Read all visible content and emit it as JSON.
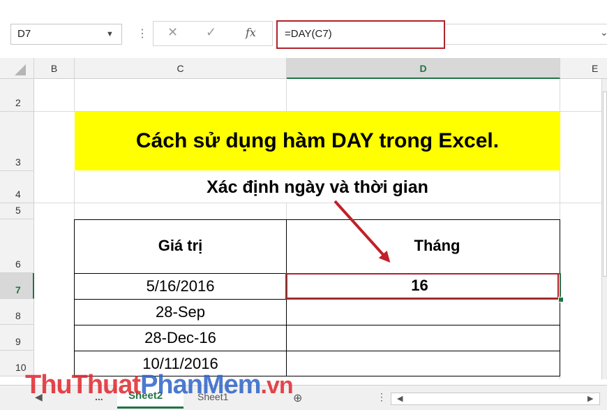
{
  "formula_bar": {
    "name_box": "D7",
    "formula": "=DAY(C7)",
    "fx_label": "fx"
  },
  "columns": [
    "B",
    "C",
    "D",
    "E"
  ],
  "rows": [
    "2",
    "3",
    "4",
    "5",
    "6",
    "7",
    "8",
    "9",
    "10"
  ],
  "sheet": {
    "title": "Cách sử dụng hàm DAY trong Excel.",
    "subtitle": "Xác định ngày và thời gian",
    "table": {
      "headers": [
        "Giá trị",
        "Tháng"
      ],
      "values": [
        "5/16/2016",
        "28-Sep",
        "28-Dec-16",
        "10/11/2016"
      ],
      "result": "16"
    }
  },
  "tabs": {
    "more": "...",
    "active": "Sheet2",
    "other": "Sheet1"
  },
  "watermark": {
    "part1": "ThuThuat",
    "part2": "PhanMem",
    "part3": ".vn"
  },
  "colors": {
    "accent_green": "#217346",
    "highlight_yellow": "#ffff00",
    "annotation_red": "#b0222a"
  }
}
